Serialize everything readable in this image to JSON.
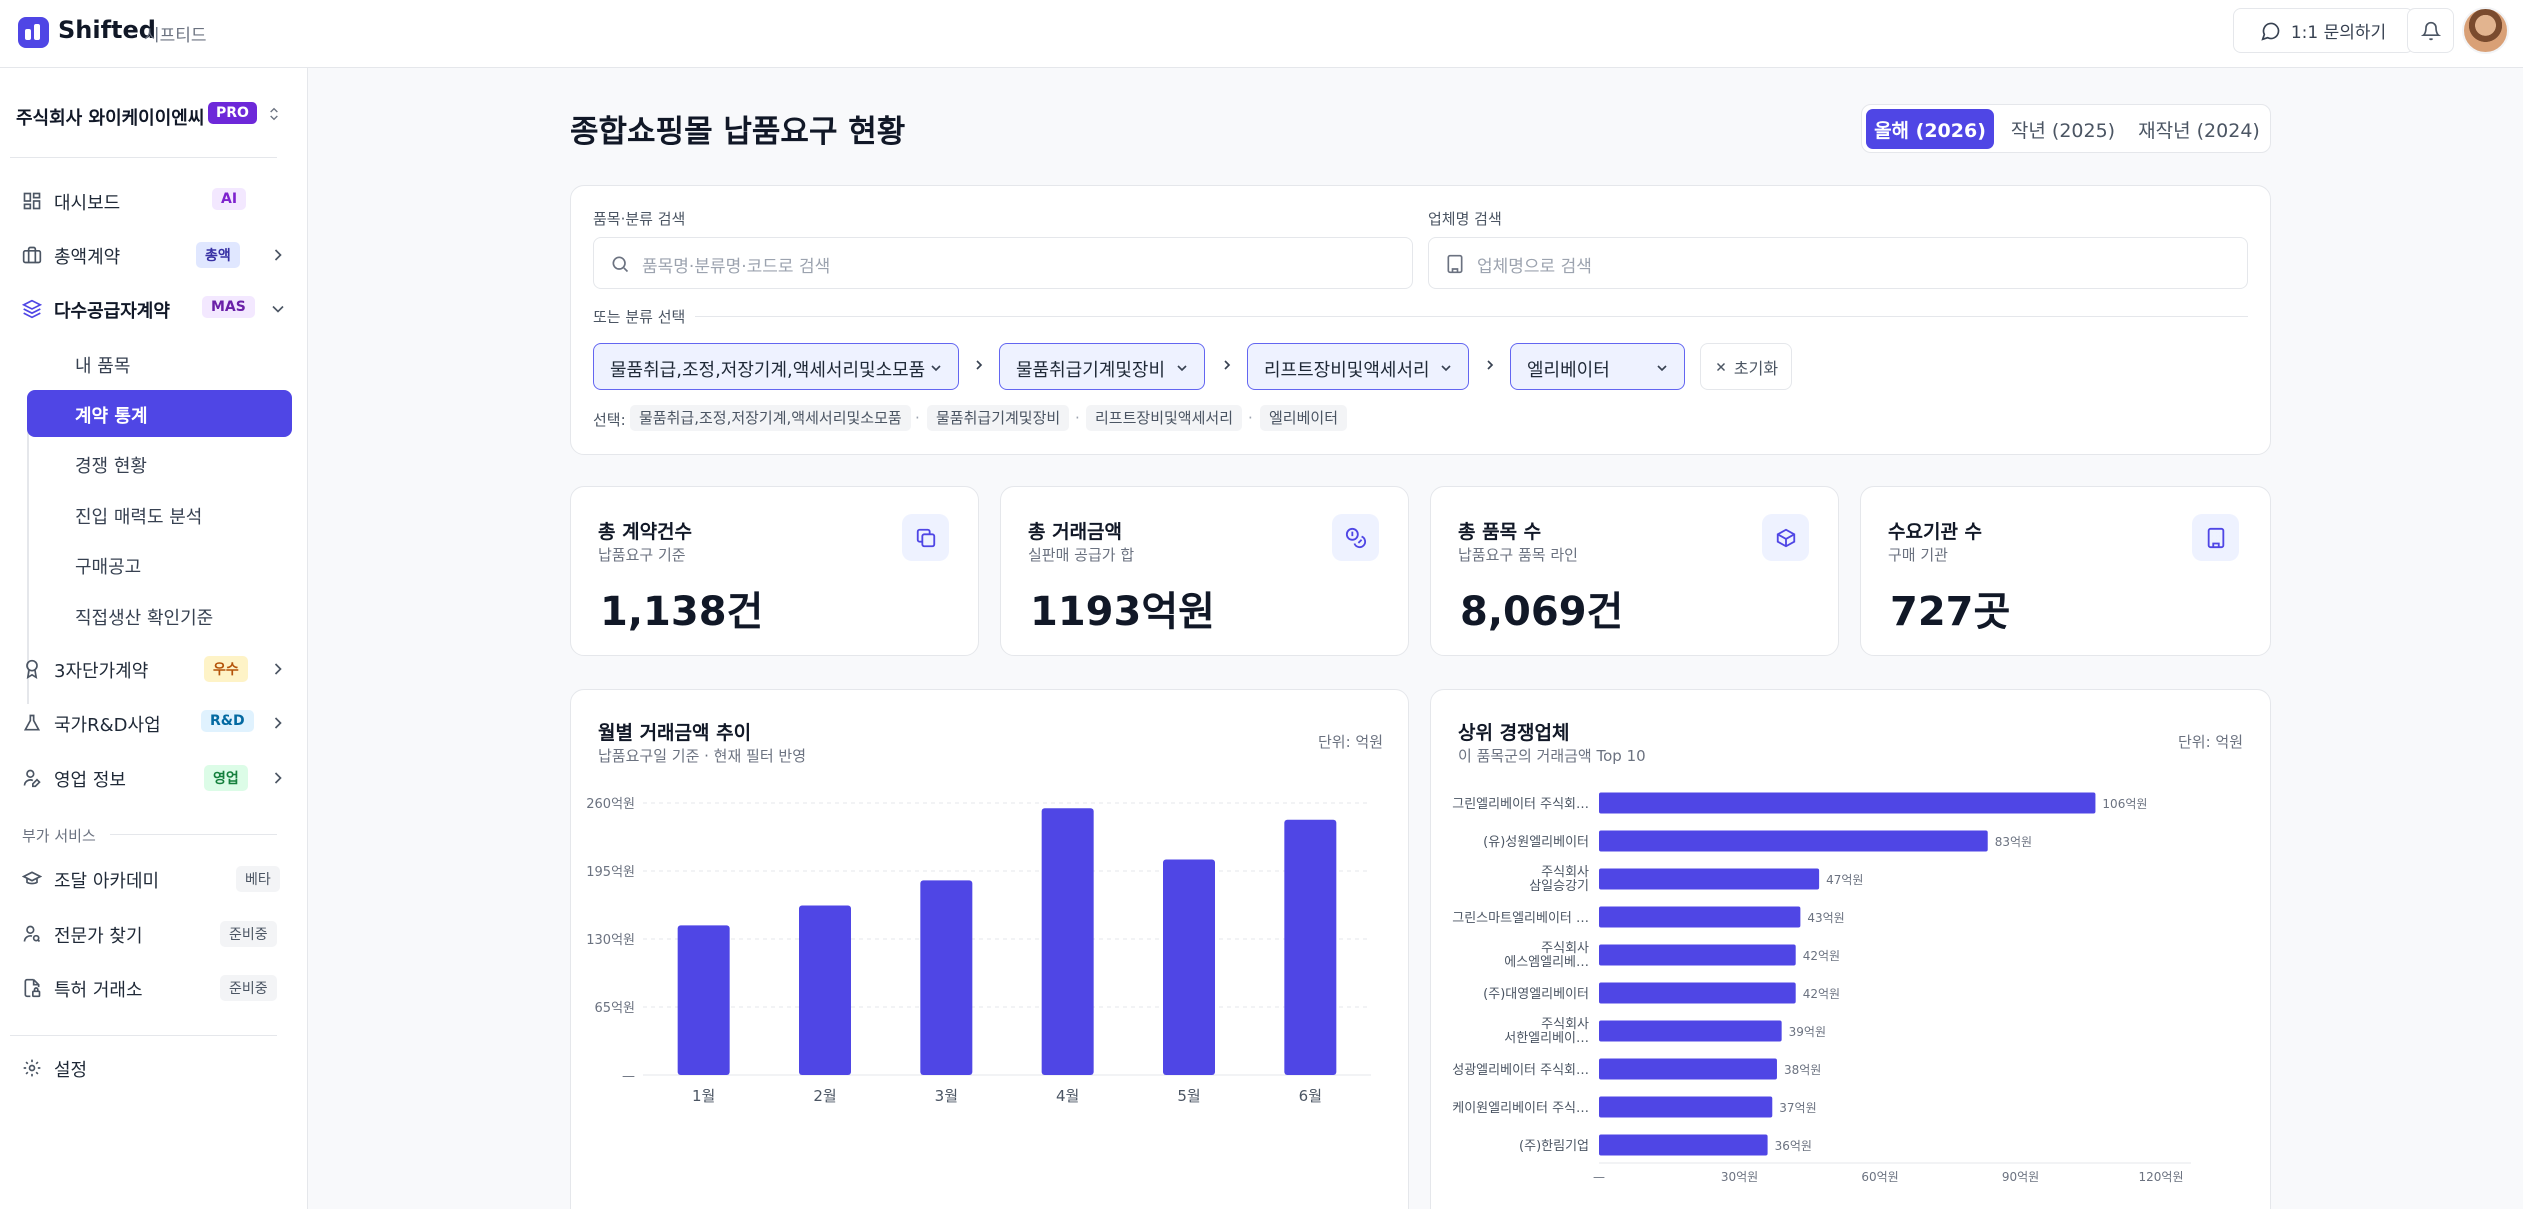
{
  "app": {
    "brand": "Shifted",
    "brand_sub": "시프티드",
    "inquiry_label": "1:1 문의하기"
  },
  "sidebar": {
    "company": "주식회사 와이케이이엔씨",
    "plan_badge": "PRO",
    "items": [
      {
        "label": "대시보드",
        "badge": "AI",
        "icon": "dashboard-icon"
      },
      {
        "label": "총액계약",
        "badge": "총액",
        "icon": "briefcase-icon"
      },
      {
        "label": "다수공급자계약",
        "badge": "MAS",
        "icon": "layers-icon"
      },
      {
        "label": "3자단가계약",
        "badge": "우수",
        "icon": "award-icon"
      },
      {
        "label": "국가R&D사업",
        "badge": "R&D",
        "icon": "flask-icon"
      },
      {
        "label": "영업 정보",
        "badge": "영업",
        "icon": "user-pen-icon"
      }
    ],
    "sub_items": [
      "내 품목",
      "계약 통계",
      "경쟁 현황",
      "진입 매력도 분석",
      "구매공고",
      "직접생산 확인기준"
    ],
    "extra_section": "부가 서비스",
    "extra_items": [
      {
        "label": "조달 아카데미",
        "badge": "베타",
        "icon": "graduation-cap-icon"
      },
      {
        "label": "전문가 찾기",
        "badge": "준비중",
        "icon": "user-search-icon"
      },
      {
        "label": "특허 거래소",
        "badge": "준비중",
        "icon": "file-lock-icon"
      }
    ],
    "settings": "설정"
  },
  "page": {
    "title": "종합쇼핑몰 납품요구 현황",
    "year_tabs": [
      "올해 (2026)",
      "작년 (2025)",
      "재작년 (2024)"
    ]
  },
  "filters": {
    "item_label": "품목·분류 검색",
    "item_placeholder": "품목명·분류명·코드로 검색",
    "vendor_label": "업체명 검색",
    "vendor_placeholder": "업체명으로 검색",
    "or_label": "또는 분류 선택",
    "selects": [
      "물품취급,조정,저장기계,액세서리및소모품",
      "물품취급기계및장비",
      "리프트장비및액세서리",
      "엘리베이터"
    ],
    "reset": "초기화",
    "selected_label": "선택:",
    "crumbs": [
      "물품취급,조정,저장기계,액세서리및소모품",
      "물품취급기계및장비",
      "리프트장비및액세서리",
      "엘리베이터"
    ]
  },
  "stats": [
    {
      "title": "총 계약건수",
      "sub": "납품요구 기준",
      "value": "1,138건",
      "icon": "copy-icon"
    },
    {
      "title": "총 거래금액",
      "sub": "실판매 공급가 합",
      "value": "1193억원",
      "icon": "coins-icon"
    },
    {
      "title": "총 품목 수",
      "sub": "납품요구 품목 라인",
      "value": "8,069건",
      "icon": "package-icon"
    },
    {
      "title": "수요기관 수",
      "sub": "구매 기관",
      "value": "727곳",
      "icon": "building-icon"
    }
  ],
  "monthly_chart": {
    "title": "월별 거래금액 추이",
    "sub": "납품요구일 기준 · 현재 필터 반영",
    "unit": "단위: 억원"
  },
  "top_chart": {
    "title": "상위 경쟁업체",
    "sub": "이 품목군의 거래금액 Top 10",
    "unit": "단위: 억원"
  },
  "chart_data": [
    {
      "type": "bar",
      "title": "월별 거래금액 추이",
      "categories": [
        "1월",
        "2월",
        "3월",
        "4월",
        "5월",
        "6월"
      ],
      "values": [
        143,
        162,
        186,
        255,
        206,
        244
      ],
      "ylim": [
        0,
        260
      ],
      "yticks": [
        0,
        65,
        130,
        195,
        260
      ],
      "ytick_labels": [
        "—",
        "65억원",
        "130억원",
        "195억원",
        "260억원"
      ],
      "grid": true,
      "colors": {
        "bar": "#4f46e5"
      }
    },
    {
      "type": "bar",
      "orientation": "horizontal",
      "title": "상위 경쟁업체",
      "categories": [
        [
          "그린엘리베이터 주식회…"
        ],
        [
          "(유)성원엘리베이터"
        ],
        [
          "주식회사",
          "삼일승강기"
        ],
        [
          "그린스마트엘리베이터 …"
        ],
        [
          "주식회사",
          "에스엠엘리베…"
        ],
        [
          "(주)대영엘리베이터"
        ],
        [
          "주식회사",
          "서한엘리베이…"
        ],
        [
          "성광엘리베이터 주식회…"
        ],
        [
          "케이원엘리베이터 주식…"
        ],
        [
          "(주)한림기업"
        ]
      ],
      "values": [
        106,
        83,
        47,
        43,
        42,
        42,
        39,
        38,
        37,
        36
      ],
      "value_labels": [
        "106억원",
        "83억원",
        "47억원",
        "43억원",
        "42억원",
        "42억원",
        "39억원",
        "38억원",
        "37억원",
        "36억원"
      ],
      "xlim": [
        0,
        120
      ],
      "xticks": [
        0,
        30,
        60,
        90,
        120
      ],
      "xtick_labels": [
        "—",
        "30억원",
        "60억원",
        "90억원",
        "120억원"
      ],
      "colors": {
        "bar": "#4f46e5"
      }
    }
  ]
}
